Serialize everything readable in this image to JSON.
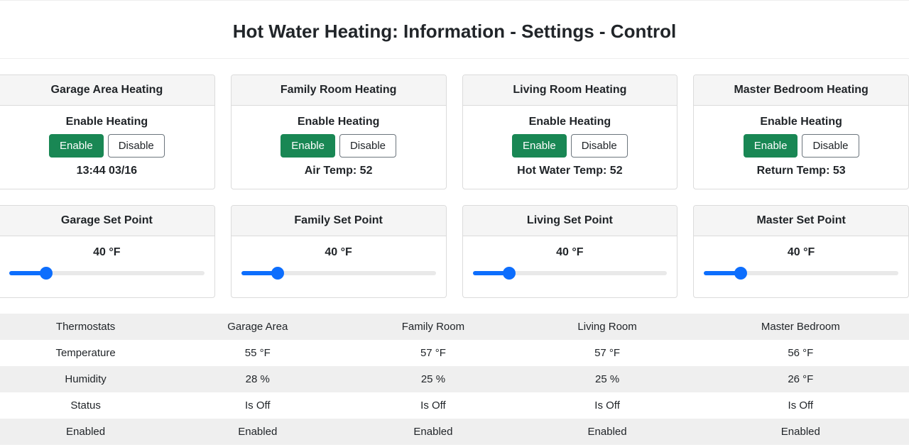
{
  "title": "Hot Water Heating: Information - Settings - Control",
  "zones": [
    {
      "id": "garage",
      "title": "Garage Area Heating",
      "enable_label": "Enable Heating",
      "enable_btn": "Enable",
      "disable_btn": "Disable",
      "info": "13:44 03/16",
      "setpoint_title": "Garage Set Point",
      "setpoint_value": "40 °F",
      "slider_value": 40,
      "slider_min": 30,
      "slider_max": 90
    },
    {
      "id": "family",
      "title": "Family Room Heating",
      "enable_label": "Enable Heating",
      "enable_btn": "Enable",
      "disable_btn": "Disable",
      "info": "Air Temp: 52",
      "setpoint_title": "Family Set Point",
      "setpoint_value": "40 °F",
      "slider_value": 40,
      "slider_min": 30,
      "slider_max": 90
    },
    {
      "id": "living",
      "title": "Living Room Heating",
      "enable_label": "Enable Heating",
      "enable_btn": "Enable",
      "disable_btn": "Disable",
      "info": "Hot Water Temp: 52",
      "setpoint_title": "Living Set Point",
      "setpoint_value": "40 °F",
      "slider_value": 40,
      "slider_min": 30,
      "slider_max": 90
    },
    {
      "id": "master",
      "title": "Master Bedroom Heating",
      "enable_label": "Enable Heating",
      "enable_btn": "Enable",
      "disable_btn": "Disable",
      "info": "Return Temp: 53",
      "setpoint_title": "Master Set Point",
      "setpoint_value": "40 °F",
      "slider_value": 40,
      "slider_min": 30,
      "slider_max": 90
    }
  ],
  "table": {
    "header": [
      "Thermostats",
      "Garage Area",
      "Family Room",
      "Living Room",
      "Master Bedroom"
    ],
    "rows": [
      {
        "label": "Temperature",
        "values": [
          "55 °F",
          "57 °F",
          "57 °F",
          "56 °F"
        ]
      },
      {
        "label": "Humidity",
        "values": [
          "28 %",
          "25 %",
          "25 %",
          "26 °F"
        ]
      },
      {
        "label": "Status",
        "values": [
          "Is Off",
          "Is Off",
          "Is Off",
          "Is Off"
        ]
      },
      {
        "label": "Enabled",
        "values": [
          "Enabled",
          "Enabled",
          "Enabled",
          "Enabled"
        ]
      }
    ]
  }
}
